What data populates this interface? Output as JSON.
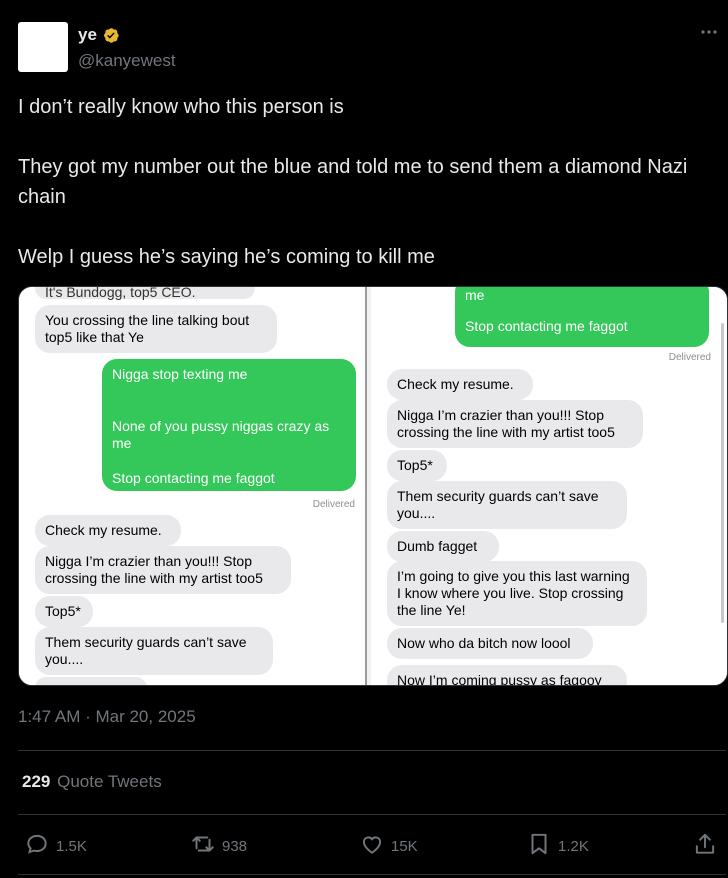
{
  "author": {
    "display_name": "ye",
    "handle": "@kanyewest"
  },
  "tweet": {
    "lines": [
      "I don’t really know who this person is",
      "They got my number out the blue and told me to send them a diamond Nazi chain",
      "Welp I guess he’s saying he’s coming to kill me"
    ],
    "timestamp": "1:47 AM · Mar 20, 2025"
  },
  "media": {
    "left": {
      "top_cut": "It's Bundogg, top5 CEO.",
      "m1": "You crossing the line talking bout top5 like that Ye",
      "sent_a": "Nigga stop texting me",
      "sent_b": "None of you pussy niggas crazy as me",
      "sent_c": "Stop contacting me faggot",
      "delivered": "Delivered",
      "m2": "Check my resume.",
      "m3": "Nigga I’m crazier than you!!! Stop crossing the line with my artist too5",
      "m4": "Top5*",
      "m5": "Them security guards can’t save you...."
    },
    "right": {
      "sent_top": "me",
      "sent_c": "Stop contacting me faggot",
      "delivered": "Delivered",
      "m1": "Check my resume.",
      "m2": "Nigga I’m crazier than you!!! Stop crossing the line with my artist too5",
      "m3": "Top5*",
      "m4": "Them security guards can’t save you....",
      "m5": "Dumb fagget",
      "m6": "I’m going to give you this last warning I know where you live. Stop crossing the line Ye!",
      "m7": "Now who da bitch now loool",
      "m8": "Now I’m coming pussy as fagooy"
    }
  },
  "quote_tweets": {
    "count": "229",
    "label": "Quote Tweets"
  },
  "actions": {
    "replies": "1.5K",
    "reposts": "938",
    "likes": "15K",
    "bookmarks": "1.2K"
  },
  "colors": {
    "background": "#000000",
    "text": "#e7e9ea",
    "muted": "#71767b",
    "verified_badge": "#e8b830",
    "imessage_green": "#34c759",
    "imessage_gray": "#e9e9eb"
  },
  "icons": [
    "verified-badge-icon",
    "more-icon",
    "reply-icon",
    "repost-icon",
    "like-icon",
    "bookmark-icon",
    "share-icon"
  ]
}
